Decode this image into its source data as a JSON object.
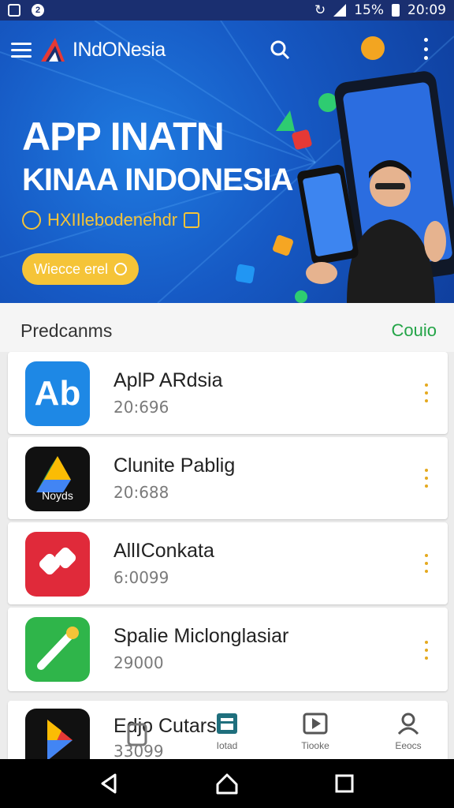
{
  "status_bar": {
    "battery": "15%",
    "time": "20:09"
  },
  "app_bar": {
    "brand": "INdONesia"
  },
  "hero": {
    "title": "APP INATN",
    "subtitle": "KINAA INDONESIA",
    "tagline": "HXIIlebodenehdr",
    "button_label": "Wiecce erel"
  },
  "section": {
    "title": "Predcanms",
    "link": "Couio"
  },
  "apps": [
    {
      "name": "AplP ARdsia",
      "meta": "20:696",
      "icon": "ab-app-icon",
      "icon_text": "Ab"
    },
    {
      "name": "Clunite Pablig",
      "meta": "20:688",
      "icon": "noyas-app-icon",
      "icon_text": "Noyds"
    },
    {
      "name": "AllIConkata",
      "meta": "6:0099",
      "icon": "red-app-icon",
      "icon_text": ""
    },
    {
      "name": "Spalie Miclonglasiar",
      "meta": "29000",
      "icon": "green-app-icon",
      "icon_text": ""
    },
    {
      "name": "Edjo Cutars",
      "meta": "33099",
      "icon": "drive-app-icon",
      "icon_text": ""
    }
  ],
  "tabs": [
    {
      "label": "",
      "icon": "games-icon"
    },
    {
      "label": "Iotad",
      "icon": "apps-icon"
    },
    {
      "label": "Tiooke",
      "icon": "movies-icon"
    },
    {
      "label": "Eeocs",
      "icon": "account-icon"
    }
  ],
  "colors": {
    "primary": "#1659c4",
    "accent": "#f5c438",
    "link": "#23a447",
    "statusbar": "#1a2f70"
  }
}
